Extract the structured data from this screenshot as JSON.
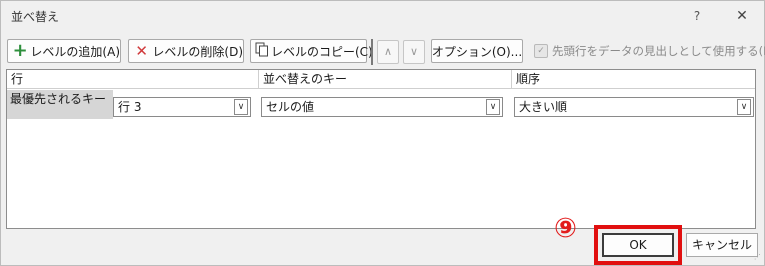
{
  "dialog": {
    "title": "並べ替え",
    "help_label": "?",
    "close_label": "✕"
  },
  "toolbar": {
    "add_level": "レベルの追加(A)",
    "delete_level": "レベルの削除(D)",
    "copy_level": "レベルのコピー(C)",
    "move_up": "∧",
    "move_down": "∨",
    "options": "オプション(O)...",
    "header_checkbox_label": "先頭行をデータの見出しとして使用する(H)",
    "header_checkbox_checked": true
  },
  "grid": {
    "headers": {
      "column": "行",
      "sort_on": "並べ替えのキー",
      "order": "順序"
    },
    "rows": [
      {
        "label": "最優先されるキー",
        "column": "行 3",
        "sort_on": "セルの値",
        "order": "大きい順"
      }
    ]
  },
  "annotation": {
    "marker": "⑨"
  },
  "buttons": {
    "ok": "OK",
    "cancel": "キャンセル"
  },
  "colors": {
    "highlight": "#e10f0f"
  }
}
